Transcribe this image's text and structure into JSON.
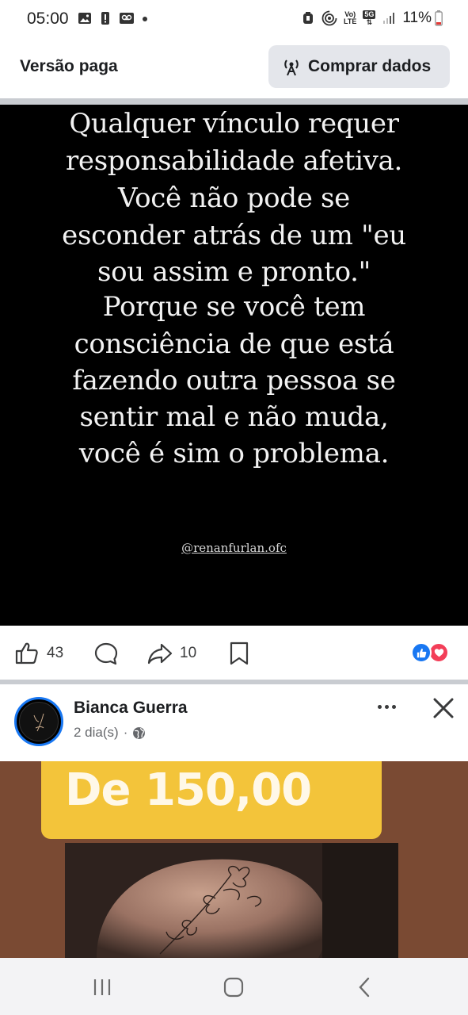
{
  "status_bar": {
    "time": "05:00",
    "network_label_top": "Vo)",
    "network_label_bottom": "LTE",
    "net_gen": "5G",
    "battery": "11%"
  },
  "topbar": {
    "title": "Versão paga",
    "buy_label": "Comprar dados"
  },
  "post1": {
    "quote_lines": [
      "Qualquer vínculo requer",
      "responsabilidade afetiva.",
      "Você não pode se",
      "esconder atrás de um \"eu",
      "sou assim e pronto.\"",
      "Porque se você tem",
      "consciência de que está",
      "fazendo outra pessoa se",
      "sentir mal e não muda,",
      "você é sim o problema."
    ],
    "handle": "@renanfurlan.ofc",
    "likes": "43",
    "shares": "10"
  },
  "post2": {
    "author": "Bianca Guerra",
    "time": "2 dia(s)",
    "separator": "·",
    "banner_text": "De 150,00"
  },
  "colors": {
    "facebook_blue": "#1877f2",
    "love_red": "#f33e58",
    "banner_yellow": "#f3c43a"
  },
  "icons": [
    "image-icon",
    "alert-icon",
    "voicemail-icon",
    "alarm-icon",
    "hotspot-icon",
    "signal-icon",
    "battery-icon",
    "antenna-icon",
    "like-icon",
    "comment-icon",
    "share-icon",
    "save-icon",
    "globe-icon",
    "more-icon",
    "close-icon",
    "recent-apps-icon",
    "home-icon",
    "back-icon"
  ]
}
